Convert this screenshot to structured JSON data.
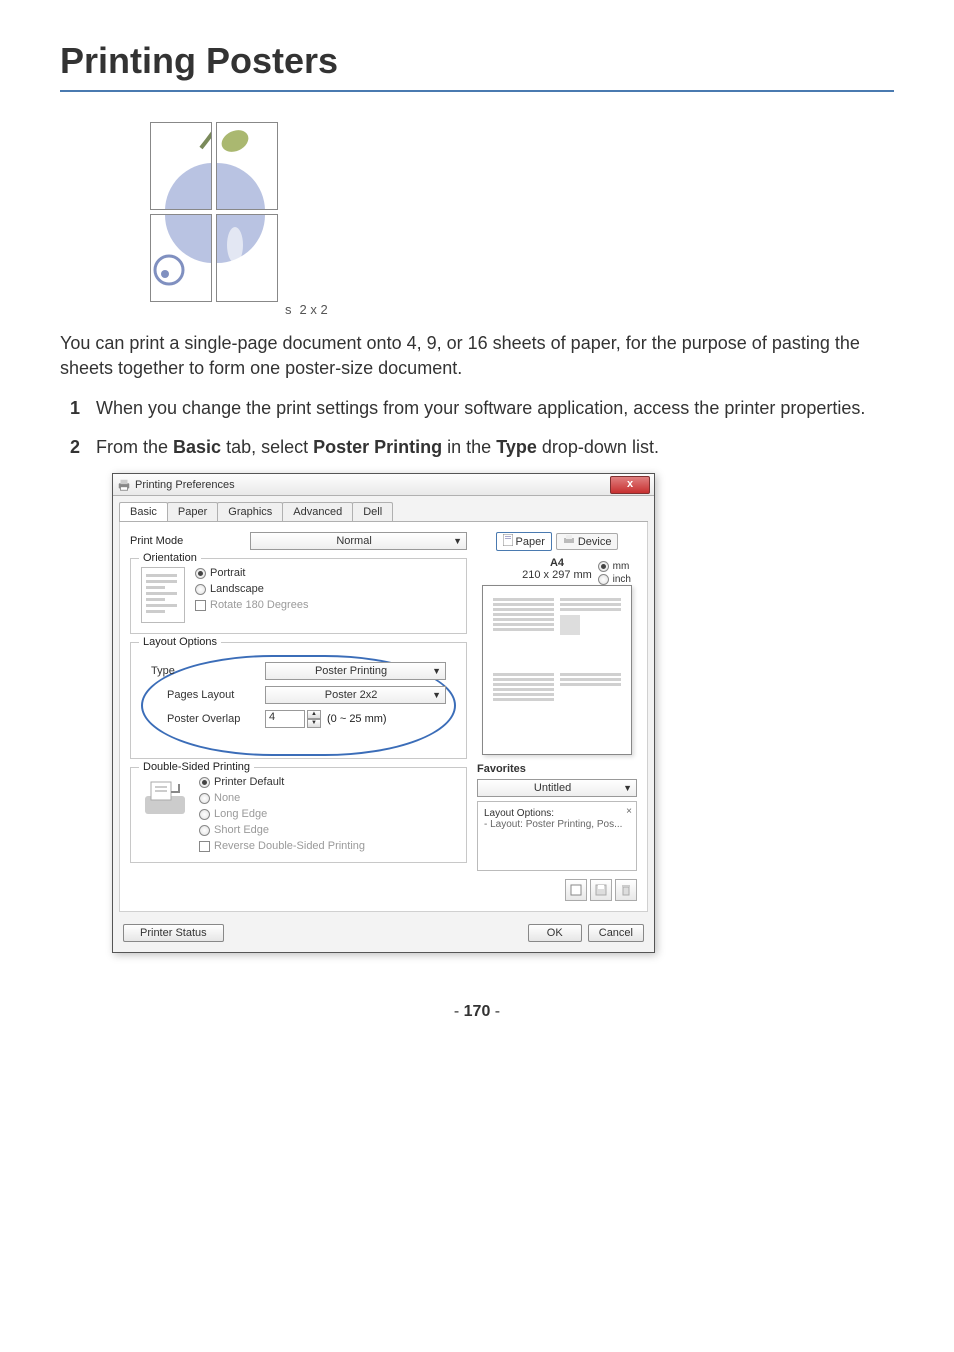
{
  "title": "Printing Posters",
  "poster_label": "2 x 2",
  "intro": "You can print a single-page document onto 4, 9, or 16 sheets of paper, for the purpose of pasting the sheets together to form one poster-size document.",
  "steps": {
    "one": "When you change the print settings from your software application, access the printer properties.",
    "two_before_basic": "From the ",
    "two_basic": "Basic",
    "two_mid1": " tab, select ",
    "two_poster": "Poster Printing",
    "two_mid2": " in the ",
    "two_type": "Type",
    "two_end": " drop-down list."
  },
  "dialog": {
    "title": "Printing Preferences",
    "close": "x",
    "tabs": [
      "Basic",
      "Paper",
      "Graphics",
      "Advanced",
      "Dell"
    ],
    "print_mode_label": "Print Mode",
    "print_mode_value": "Normal",
    "orientation": {
      "label": "Orientation",
      "portrait": "Portrait",
      "landscape": "Landscape",
      "rotate": "Rotate 180 Degrees"
    },
    "layout": {
      "label": "Layout Options",
      "type_label": "Type",
      "type_value": "Poster Printing",
      "pages_layout_label": "Pages Layout",
      "pages_layout_value": "Poster 2x2",
      "overlap_label": "Poster Overlap",
      "overlap_value": "4",
      "overlap_range": "(0 ~ 25 mm)"
    },
    "duplex": {
      "label": "Double-Sided Printing",
      "default": "Printer Default",
      "none": "None",
      "long": "Long Edge",
      "short": "Short Edge",
      "reverse": "Reverse Double-Sided Printing"
    },
    "preview": {
      "tab_paper": "Paper",
      "tab_device": "Device",
      "size": "A4",
      "dims": "210 x 297 mm",
      "unit_mm": "mm",
      "unit_inch": "inch"
    },
    "favorites": {
      "title": "Favorites",
      "value": "Untitled",
      "opt_label": "Layout Options:",
      "opt_detail": "- Layout: Poster Printing, Pos..."
    },
    "footer": {
      "status": "Printer Status",
      "ok": "OK",
      "cancel": "Cancel"
    }
  },
  "page_number": "170"
}
